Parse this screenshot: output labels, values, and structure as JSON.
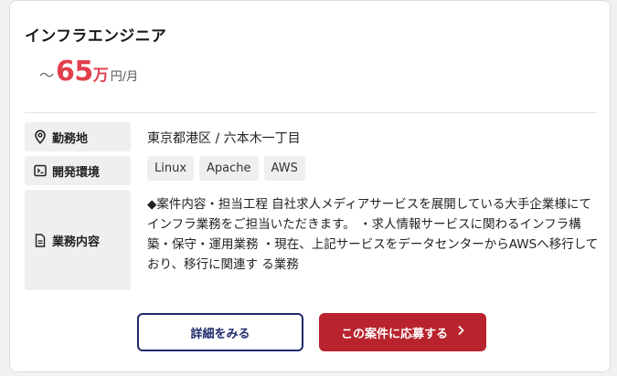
{
  "job": {
    "title": "インフラエンジニア",
    "salary": {
      "prefix": "～",
      "amount": "65",
      "unit_man": "万",
      "unit": "円/月"
    }
  },
  "details": {
    "location_label": "勤務地",
    "location_value": "東京都港区 / 六本木一丁目",
    "environment_label": "開発環境",
    "environment_tags": [
      "Linux",
      "Apache",
      "AWS"
    ],
    "description_label": "業務内容",
    "description_text": "◆案件内容・担当工程 自社求人メディアサービスを展開している大手企業様にてインフラ業務をご担当いただきます。 ・求人情報サービスに関わるインフラ構築・保守・運用業務 ・現在、上記サービスをデータセンターからAWSへ移行しており、移行に関連す る業務"
  },
  "actions": {
    "detail_label": "詳細をみる",
    "apply_label": "この案件に応募する",
    "apply_icon": "chevron-right-icon"
  },
  "colors": {
    "salary_accent": "#e2404d",
    "detail_border": "#1e2a6b",
    "apply_bg": "#b8232d"
  }
}
